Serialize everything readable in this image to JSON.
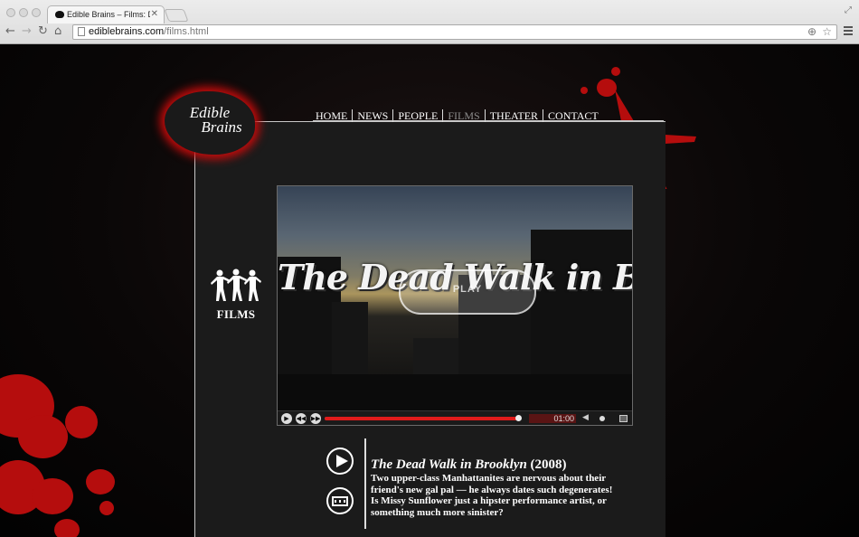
{
  "browser": {
    "tab_title": "Edible Brains – Films: Dead",
    "tab_close": "✕",
    "url_host": "ediblebrains.com",
    "url_path": "/films.html",
    "back_icon": "arrow-left-icon",
    "forward_icon": "arrow-right-icon",
    "reload_icon": "reload-icon",
    "home_icon": "home-icon"
  },
  "site": {
    "logo_line1": "Edible",
    "logo_line2": "Brains",
    "nav": [
      {
        "label": "HOME",
        "active": false
      },
      {
        "label": "NEWS",
        "active": false
      },
      {
        "label": "PEOPLE",
        "active": false
      },
      {
        "label": "FILMS",
        "active": true
      },
      {
        "label": "THEATER",
        "active": false
      },
      {
        "label": "CONTACT",
        "active": false
      }
    ],
    "section_label": "FILMS"
  },
  "video": {
    "overlay_title": "The Dead Walk in Brooklyn",
    "play_label": "PLAY",
    "time": "01:00",
    "progress_fraction": 0.99
  },
  "film": {
    "title": "The Dead Walk in Brooklyn",
    "year": "(2008)",
    "description": "Two upper-class Manhattanites are nervous about their friend's new gal pal — he always dates such degenerates! Is Missy Sunflower just a hipster performance artist, or something much more sinister?"
  },
  "colors": {
    "blood_red": "#b50d0d",
    "nav_active": "#8c8c8c",
    "progress_red": "#e01b1b"
  }
}
